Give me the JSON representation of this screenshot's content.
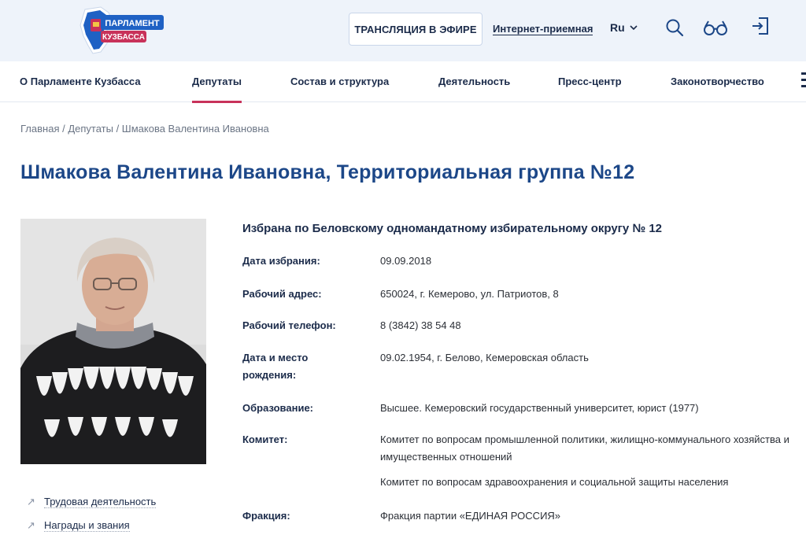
{
  "header": {
    "logo": {
      "line1": "ПАРЛАМЕНТ",
      "line2": "КУЗБАССА"
    },
    "broadcast_label": "ТРАНСЛЯЦИЯ В ЭФИРЕ",
    "reception_label": "Интернет-приемная",
    "language": "Ru",
    "icons": [
      "search-icon",
      "glasses-icon",
      "login-icon"
    ]
  },
  "nav": {
    "items": [
      {
        "label": "О Парламенте Кузбасса"
      },
      {
        "label": "Депутаты"
      },
      {
        "label": "Состав и структура"
      },
      {
        "label": "Деятельность"
      },
      {
        "label": "Пресс-центр"
      },
      {
        "label": "Законотворчество"
      }
    ],
    "active": "Депутаты"
  },
  "breadcrumb": {
    "home": "Главная",
    "section": "Депутаты",
    "current": "Шмакова Валентина Ивановна",
    "separator": " / "
  },
  "title": "Шмакова Валентина Ивановна, Территориальная группа №12",
  "side_links": [
    {
      "label": "Трудовая деятельность"
    },
    {
      "label": "Награды и звания"
    }
  ],
  "details": {
    "elected": "Избрана по Беловскому одномандатному избирательному округу № 12",
    "rows": [
      {
        "label": "Дата избрания:",
        "value": "09.09.2018"
      },
      {
        "label": "Рабочий адрес:",
        "value": "650024, г. Кемерово, ул. Патриотов, 8"
      },
      {
        "label": "Рабочий телефон:",
        "value": "8 (3842) 38 54 48"
      },
      {
        "label": "Дата и место рождения:",
        "value": "09.02.1954, г. Белово, Кемеровская область"
      },
      {
        "label": "Образование:",
        "value": "Высшее. Кемеровский государственный университет, юрист (1977)"
      },
      {
        "label": "Комитет:",
        "value": "Комитет по вопросам промышленной политики, жилищно-коммунального хозяйства и имущественных отношений"
      },
      {
        "label": "",
        "value": "Комитет по вопросам здравоохранения и социальной защиты населения"
      },
      {
        "label": "Фракция:",
        "value": "Фракция партии «ЕДИНАЯ РОССИЯ»"
      }
    ]
  },
  "colors": {
    "title": "#1c4788",
    "accent": "#c8325a",
    "header_bg": "#eef3fa",
    "text_dark": "#1b2b4a"
  }
}
